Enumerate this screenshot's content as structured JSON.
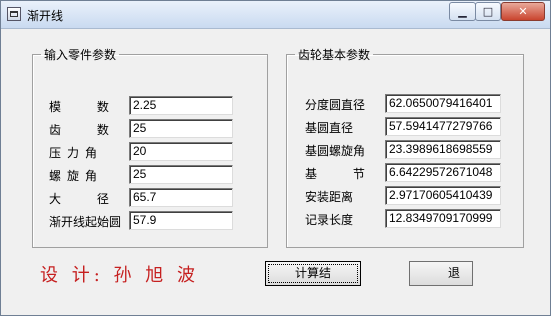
{
  "window": {
    "title": "渐开线",
    "icon": "app-window-icon",
    "controls": {
      "minimize": "▁",
      "maximize": "□",
      "close": "✕"
    }
  },
  "input_group": {
    "legend": "输入零件参数",
    "fields": [
      {
        "label": "模 数",
        "value": "2.25"
      },
      {
        "label": "齿 数",
        "value": "25"
      },
      {
        "label": "压力角",
        "value": "20"
      },
      {
        "label": "螺旋角",
        "value": "25"
      },
      {
        "label": "大 径",
        "value": "65.7"
      },
      {
        "label": "渐开线起始圆",
        "value": "57.9"
      }
    ]
  },
  "output_group": {
    "legend": "齿轮基本参数",
    "fields": [
      {
        "label": "分度圆直径",
        "value": "62.0650079416401"
      },
      {
        "label": "基圆直径",
        "value": "57.5941477279766"
      },
      {
        "label": "基圆螺旋角",
        "value": "23.3989618698559"
      },
      {
        "label": "基 节",
        "value": "6.64229572671048"
      },
      {
        "label": "安装距离",
        "value": "2.97170605410439"
      },
      {
        "label": "记录长度",
        "value": "12.8349709170999"
      }
    ]
  },
  "designer_text": "设 计:  孙 旭 波",
  "buttons": {
    "calculate": "计算结",
    "exit": "退"
  },
  "colors": {
    "designer_text": "#c62020",
    "title_gradient_top": "#eaf1fb",
    "close_button": "#c9442e"
  }
}
